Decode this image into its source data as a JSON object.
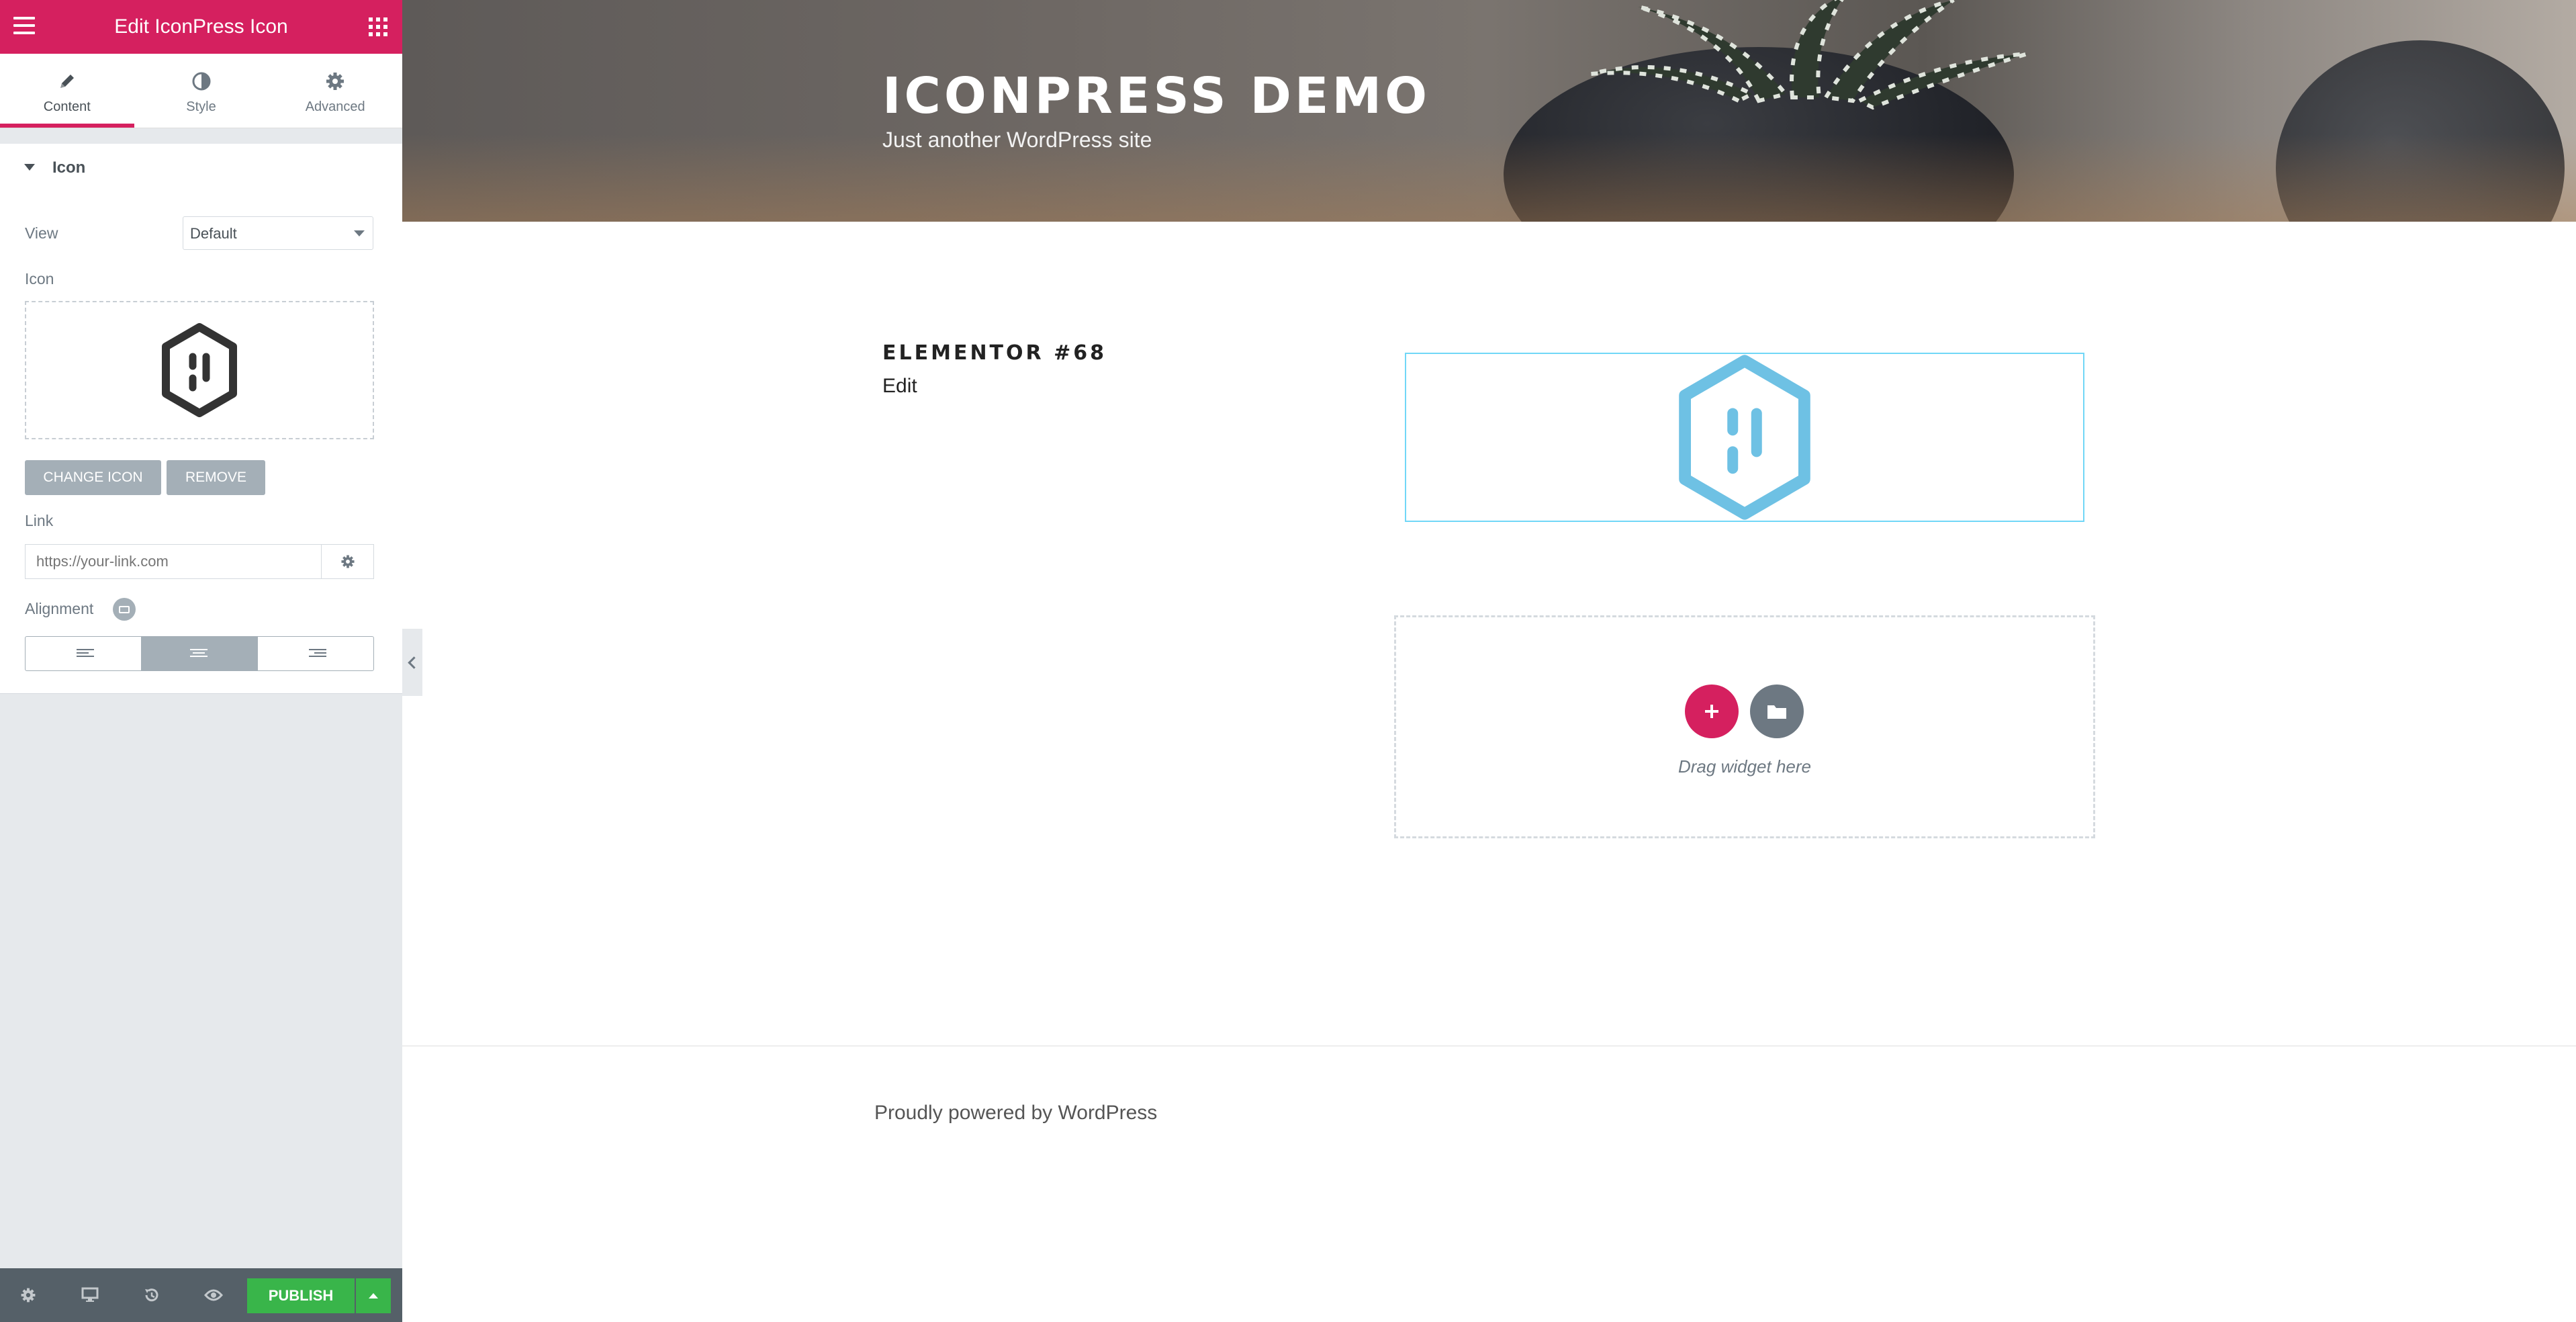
{
  "panel": {
    "header_title": "Edit IconPress Icon",
    "tabs": [
      {
        "label": "Content",
        "icon": "pencil-icon",
        "active": true
      },
      {
        "label": "Style",
        "icon": "contrast-icon",
        "active": false
      },
      {
        "label": "Advanced",
        "icon": "gear-icon",
        "active": false
      }
    ],
    "section_title": "Icon",
    "view": {
      "label": "View",
      "value": "Default"
    },
    "icon_label": "Icon",
    "change_icon_label": "CHANGE ICON",
    "remove_label": "REMOVE",
    "link": {
      "label": "Link",
      "placeholder": "https://your-link.com"
    },
    "alignment": {
      "label": "Alignment",
      "options": [
        "left",
        "center",
        "right"
      ],
      "selected": "center"
    }
  },
  "footer_bar": {
    "icons": [
      "settings-icon",
      "desktop-icon",
      "history-icon",
      "eye-icon"
    ],
    "publish_label": "PUBLISH"
  },
  "preview": {
    "site_title": "ICONPRESS DEMO",
    "site_tagline": "Just another WordPress site",
    "entry_title": "ELEMENTOR #68",
    "edit_link": "Edit",
    "drop_zone_text": "Drag widget here",
    "footer_text": "Proudly powered by WordPress"
  },
  "colors": {
    "brand": "#d5205f",
    "publish": "#39b54a",
    "icon_blue": "#6ec1e4",
    "widget_border": "#71d7f7"
  }
}
